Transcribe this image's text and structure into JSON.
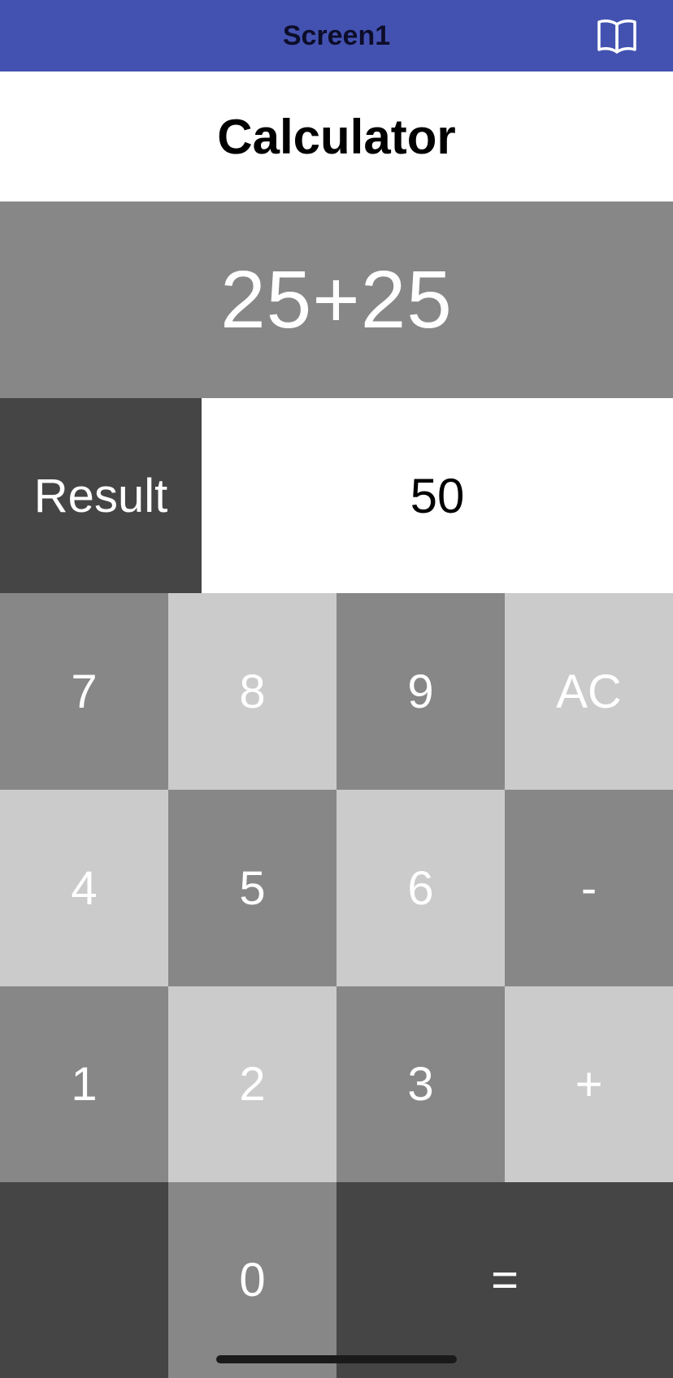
{
  "colors": {
    "appbar": "#4352b1",
    "expression_bg": "#878787",
    "result_label_bg": "#454545",
    "key_dark": "#878787",
    "key_light": "#cbcbcb",
    "key_black": "#454545"
  },
  "appbar": {
    "title": "Screen1",
    "icon": "book-open-icon"
  },
  "header": {
    "title": "Calculator"
  },
  "display": {
    "expression": "25+25",
    "result_label": "Result",
    "result_value": "50"
  },
  "keypad": {
    "k7": "7",
    "k8": "8",
    "k9": "9",
    "ac": "AC",
    "k4": "4",
    "k5": "5",
    "k6": "6",
    "minus": "-",
    "k1": "1",
    "k2": "2",
    "k3": "3",
    "plus": "+",
    "blank": "",
    "k0": "0",
    "equals": "="
  }
}
